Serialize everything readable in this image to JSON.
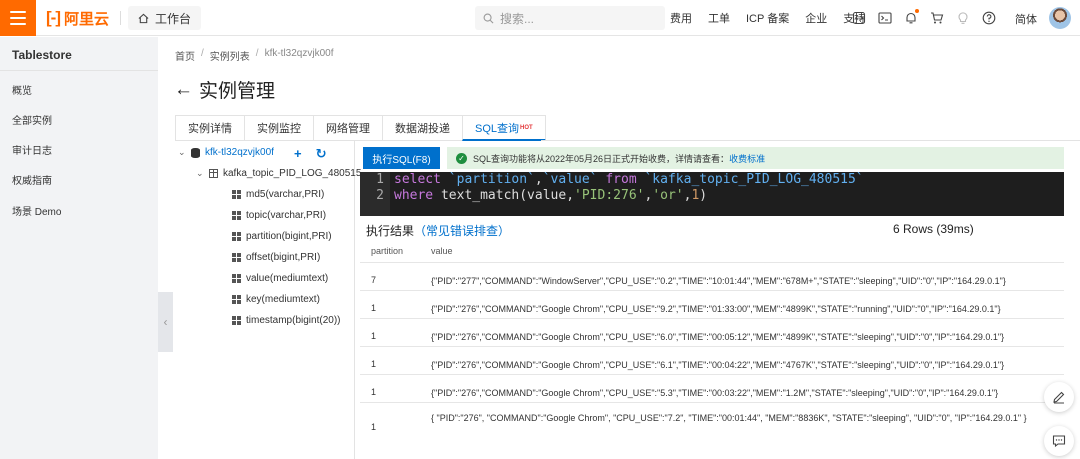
{
  "topbar": {
    "logo_text": "阿里云",
    "workbench": "工作台",
    "search_placeholder": "搜索...",
    "nav": [
      "费用",
      "工单",
      "ICP 备案",
      "企业",
      "支持"
    ],
    "lang": "简体"
  },
  "sidebar": {
    "title": "Tablestore",
    "items": [
      "概览",
      "全部实例",
      "审计日志",
      "权威指南",
      "场景 Demo"
    ]
  },
  "breadcrumb": [
    "首页",
    "实例列表",
    "kfk-tl32qzvjk00f"
  ],
  "page_title": "实例管理",
  "tabs": [
    "实例详情",
    "实例监控",
    "网络管理",
    "数据湖投递",
    "SQL查询"
  ],
  "tab_badge": "HOT",
  "tree": {
    "instance": "kfk-tl32qzvjk00f",
    "table": "kafka_topic_PID_LOG_480515",
    "columns": [
      "md5(varchar,PRI)",
      "topic(varchar,PRI)",
      "partition(bigint,PRI)",
      "offset(bigint,PRI)",
      "value(mediumtext)",
      "key(mediumtext)",
      "timestamp(bigint(20))"
    ]
  },
  "exec_button": "执行SQL(F8)",
  "notice": {
    "text": "SQL查询功能将从2022年05月26日正式开始收费，详情请查看：",
    "link": "收费标准"
  },
  "editor": {
    "line_numbers": [
      "1",
      "2"
    ]
  },
  "result": {
    "title": "执行结果",
    "help_link": "（常见错误排查）",
    "summary": "6 Rows (39ms)",
    "columns": [
      "partition",
      "value"
    ],
    "rows": [
      {
        "partition": "7",
        "value": "{\"PID\":\"277\",\"COMMAND\":\"WindowServer\",\"CPU_USE\":\"0.2\",\"TIME\":\"10:01:44\",\"MEM\":\"678M+\",\"STATE\":\"sleeping\",\"UID\":\"0\",\"IP\":\"164.29.0.1\"}"
      },
      {
        "partition": "1",
        "value": "{\"PID\":\"276\",\"COMMAND\":\"Google Chrom\",\"CPU_USE\":\"9.2\",\"TIME\":\"01:33:00\",\"MEM\":\"4899K\",\"STATE\":\"running\",\"UID\":\"0\",\"IP\":\"164.29.0.1\"}"
      },
      {
        "partition": "1",
        "value": "{\"PID\":\"276\",\"COMMAND\":\"Google Chrom\",\"CPU_USE\":\"6.0\",\"TIME\":\"00:05:12\",\"MEM\":\"4899K\",\"STATE\":\"sleeping\",\"UID\":\"0\",\"IP\":\"164.29.0.1\"}"
      },
      {
        "partition": "1",
        "value": "{\"PID\":\"276\",\"COMMAND\":\"Google Chrom\",\"CPU_USE\":\"6.1\",\"TIME\":\"00:04:22\",\"MEM\":\"4767K\",\"STATE\":\"sleeping\",\"UID\":\"0\",\"IP\":\"164.29.0.1\"}"
      },
      {
        "partition": "1",
        "value": "{\"PID\":\"276\",\"COMMAND\":\"Google Chrom\",\"CPU_USE\":\"5.3\",\"TIME\":\"00:03:22\",\"MEM\":\"1.2M\",\"STATE\":\"sleeping\",\"UID\":\"0\",\"IP\":\"164.29.0.1\"}"
      },
      {
        "partition": "1",
        "value": "{ \"PID\":\"276\", \"COMMAND\":\"Google Chrom\", \"CPU_USE\":\"7.2\", \"TIME\":\"00:01:44\", \"MEM\":\"8836K\", \"STATE\":\"sleeping\", \"UID\":\"0\", \"IP\":\"164.29.0.1\" }"
      }
    ]
  },
  "colors": {
    "brand": "#ff6a00",
    "accent": "#0070cc",
    "editor_bg": "#1e1e1e",
    "notice_bg": "#e3f2e3"
  }
}
